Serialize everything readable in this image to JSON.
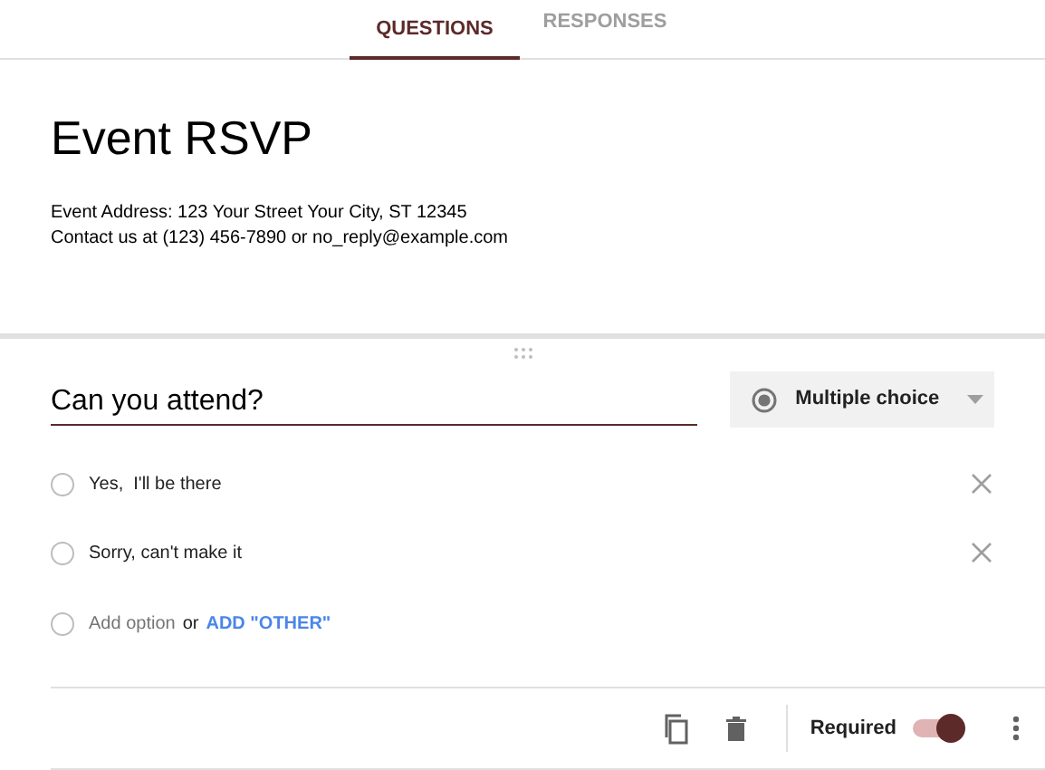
{
  "tabs": [
    {
      "label": "QUESTIONS",
      "selected": true
    },
    {
      "label": "RESPONSES",
      "selected": false
    }
  ],
  "form": {
    "title": "Event RSVP",
    "description": [
      "Event Address: 123 Your Street Your City, ST 12345",
      "Contact us at (123) 456-7890 or no_reply@example.com"
    ]
  },
  "question": {
    "title": "Can you attend?",
    "type": "Multiple choice",
    "options": [
      {
        "label": "Yes,  I'll be there"
      },
      {
        "label": "Sorry, can't make it"
      }
    ],
    "add_option": {
      "placeholder": "Add option",
      "or": "or",
      "other": "ADD \"OTHER\""
    },
    "required_label": "Required",
    "required": true
  }
}
